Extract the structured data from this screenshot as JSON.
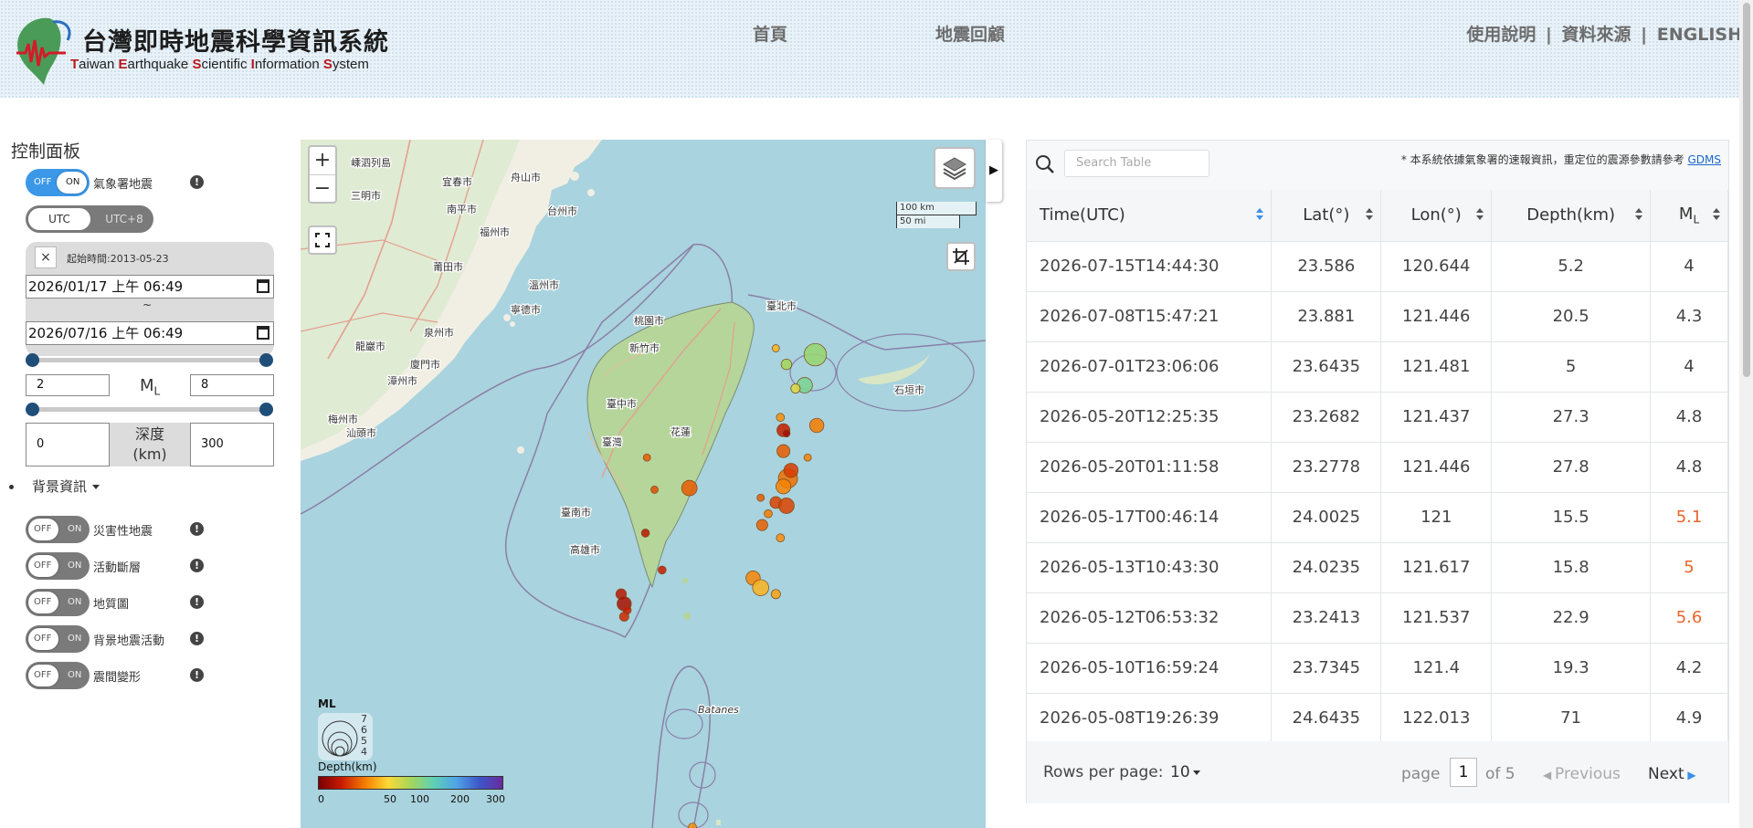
{
  "header": {
    "title_zh": "台灣即時地震科學資訊系統",
    "title_en_parts": [
      {
        "cap": "T",
        "rest": "aiwan "
      },
      {
        "cap": "E",
        "rest": "arthquake "
      },
      {
        "cap": "S",
        "rest": "cientific "
      },
      {
        "cap": "I",
        "rest": "nformation "
      },
      {
        "cap": "S",
        "rest": "ystem"
      }
    ],
    "nav": [
      "首頁",
      "地震回顧"
    ],
    "links": [
      "使用說明",
      "資料來源",
      "ENGLISH"
    ],
    "link_separator": "|"
  },
  "panel": {
    "title": "控制面板",
    "cwa_toggle": {
      "off": "OFF",
      "on": "ON",
      "label": "氣象署地震",
      "state": "on"
    },
    "timezone": {
      "utc": "UTC",
      "utc8": "UTC+8"
    },
    "close": "×",
    "start_label": "起始時間:2013-05-23",
    "date_from": "2026/01/17 上午 06:49",
    "date_to": "2026/07/16 上午 06:49",
    "tilde": "~",
    "ml_min": "2",
    "ml_max": "8",
    "ml_label": "M",
    "ml_sub": "L",
    "depth_min": "0",
    "depth_max": "300",
    "depth_label_1": "深度",
    "depth_label_2": "(km)",
    "background_info": "背景資訊",
    "layers": [
      {
        "label": "災害性地震",
        "off": "OFF",
        "on": "ON",
        "state": "off"
      },
      {
        "label": "活動斷層",
        "off": "OFF",
        "on": "ON",
        "state": "off"
      },
      {
        "label": "地質圖",
        "off": "OFF",
        "on": "ON",
        "state": "off"
      },
      {
        "label": "背景地震活動",
        "off": "OFF",
        "on": "ON",
        "state": "off"
      },
      {
        "label": "震間變形",
        "off": "OFF",
        "on": "ON",
        "state": "off"
      }
    ],
    "info_mark": "!"
  },
  "map": {
    "zoom_in": "+",
    "zoom_out": "−",
    "scale_km": "100 km",
    "scale_mi": "50 mi",
    "toggle_arrow": "▶",
    "legend_ml": "ML",
    "legend_ml_values": [
      "7",
      "6",
      "5",
      "4"
    ],
    "legend_depth": "Depth(km)",
    "colorbar_ticks": [
      "0",
      "50",
      "100",
      "200",
      "300"
    ],
    "place_labels": [
      "嵊泗列島",
      "舟山市",
      "台州市",
      "溫州市",
      "寧德市",
      "福州市",
      "莆田市",
      "泉州市",
      "廈門市",
      "漳州市",
      "汕頭市",
      "臺北市",
      "桃園市",
      "新竹市",
      "臺中市",
      "花蓮",
      "臺灣",
      "臺南市",
      "高雄市",
      "石垣市",
      "Batanes",
      "宜春市",
      "三明市",
      "南平市",
      "龍巖市",
      "梅州市"
    ],
    "quakes": [
      {
        "lon": 121.81,
        "lat": 24.94,
        "ml": 6.1,
        "depth": 80
      },
      {
        "lon": 121.62,
        "lat": 24.88,
        "ml": 4.2,
        "depth": 75
      },
      {
        "lon": 121.74,
        "lat": 24.75,
        "ml": 5.0,
        "depth": 90
      },
      {
        "lon": 121.55,
        "lat": 24.98,
        "ml": 3.4,
        "depth": 40
      },
      {
        "lon": 121.68,
        "lat": 24.73,
        "ml": 4.0,
        "depth": 60
      },
      {
        "lon": 121.58,
        "lat": 24.55,
        "ml": 3.8,
        "depth": 30
      },
      {
        "lon": 121.6,
        "lat": 24.47,
        "ml": 4.6,
        "depth": 10
      },
      {
        "lon": 121.62,
        "lat": 24.45,
        "ml": 3.6,
        "depth": 5
      },
      {
        "lon": 121.82,
        "lat": 24.5,
        "ml": 4.8,
        "depth": 25
      },
      {
        "lon": 121.76,
        "lat": 24.3,
        "ml": 3.6,
        "depth": 27
      },
      {
        "lon": 121.6,
        "lat": 24.34,
        "ml": 4.6,
        "depth": 20
      },
      {
        "lon": 121.63,
        "lat": 24.17,
        "ml": 5.6,
        "depth": 23
      },
      {
        "lon": 121.65,
        "lat": 24.22,
        "ml": 4.8,
        "depth": 15
      },
      {
        "lon": 121.6,
        "lat": 24.12,
        "ml": 4.9,
        "depth": 27
      },
      {
        "lon": 121.55,
        "lat": 24.02,
        "ml": 4.4,
        "depth": 16
      },
      {
        "lon": 121.62,
        "lat": 24.0,
        "ml": 5.0,
        "depth": 16
      },
      {
        "lon": 121.45,
        "lat": 24.05,
        "ml": 3.6,
        "depth": 20
      },
      {
        "lon": 121.5,
        "lat": 23.95,
        "ml": 3.8,
        "depth": 25
      },
      {
        "lon": 121.46,
        "lat": 23.88,
        "ml": 4.3,
        "depth": 20.5
      },
      {
        "lon": 121.58,
        "lat": 23.8,
        "ml": 3.8,
        "depth": 30
      },
      {
        "lon": 121.4,
        "lat": 23.55,
        "ml": 4.8,
        "depth": 27.8
      },
      {
        "lon": 121.45,
        "lat": 23.49,
        "ml": 5.1,
        "depth": 40
      },
      {
        "lon": 121.55,
        "lat": 23.45,
        "ml": 4.0,
        "depth": 35
      },
      {
        "lon": 120.98,
        "lat": 24.11,
        "ml": 5.0,
        "depth": 20
      },
      {
        "lon": 120.7,
        "lat": 24.3,
        "ml": 3.6,
        "depth": 20
      },
      {
        "lon": 120.75,
        "lat": 24.1,
        "ml": 3.4,
        "depth": 18
      },
      {
        "lon": 120.69,
        "lat": 23.83,
        "ml": 3.8,
        "depth": 8
      },
      {
        "lon": 120.8,
        "lat": 23.6,
        "ml": 3.8,
        "depth": 10
      },
      {
        "lon": 120.53,
        "lat": 23.45,
        "ml": 4.2,
        "depth": 8
      },
      {
        "lon": 120.55,
        "lat": 23.39,
        "ml": 4.8,
        "depth": 6
      },
      {
        "lon": 120.57,
        "lat": 23.35,
        "ml": 3.8,
        "depth": 10
      },
      {
        "lon": 120.55,
        "lat": 23.31,
        "ml": 4.0,
        "depth": 12
      },
      {
        "lon": 121.0,
        "lat": 22.0,
        "ml": 3.8,
        "depth": 30
      }
    ]
  },
  "table": {
    "search_placeholder": "Search Table",
    "note": "* 本系統依據氣象署的速報資訊，重定位的震源參數請參考",
    "note_link": "GDMS",
    "columns": [
      "Time(UTC)",
      "Lat(°)",
      "Lon(°)",
      "Depth(km)",
      "M"
    ],
    "ml_sub": "L",
    "rows": [
      [
        "2026-07-15T14:44:30",
        "23.586",
        "120.644",
        "5.2",
        "4"
      ],
      [
        "2026-07-08T15:47:21",
        "23.881",
        "121.446",
        "20.5",
        "4.3"
      ],
      [
        "2026-07-01T23:06:06",
        "23.6435",
        "121.481",
        "5",
        "4"
      ],
      [
        "2026-05-20T12:25:35",
        "23.2682",
        "121.437",
        "27.3",
        "4.8"
      ],
      [
        "2026-05-20T01:11:58",
        "23.2778",
        "121.446",
        "27.8",
        "4.8"
      ],
      [
        "2026-05-17T00:46:14",
        "24.0025",
        "121",
        "15.5",
        "5.1"
      ],
      [
        "2026-05-13T10:43:30",
        "24.0235",
        "121.617",
        "15.8",
        "5"
      ],
      [
        "2026-05-12T06:53:32",
        "23.2413",
        "121.537",
        "22.9",
        "5.6"
      ],
      [
        "2026-05-10T16:59:24",
        "23.7345",
        "121.4",
        "19.3",
        "4.2"
      ],
      [
        "2026-05-08T19:26:39",
        "24.6435",
        "122.013",
        "71",
        "4.9"
      ]
    ],
    "highlight_rows": [
      5,
      6,
      7
    ],
    "highlight_color": "#e8662c",
    "rows_per_page_label": "Rows per page:",
    "rows_per_page": "10",
    "page_label": "page",
    "page": "1",
    "of_label": "of 5",
    "prev": "Previous",
    "next": "Next"
  }
}
